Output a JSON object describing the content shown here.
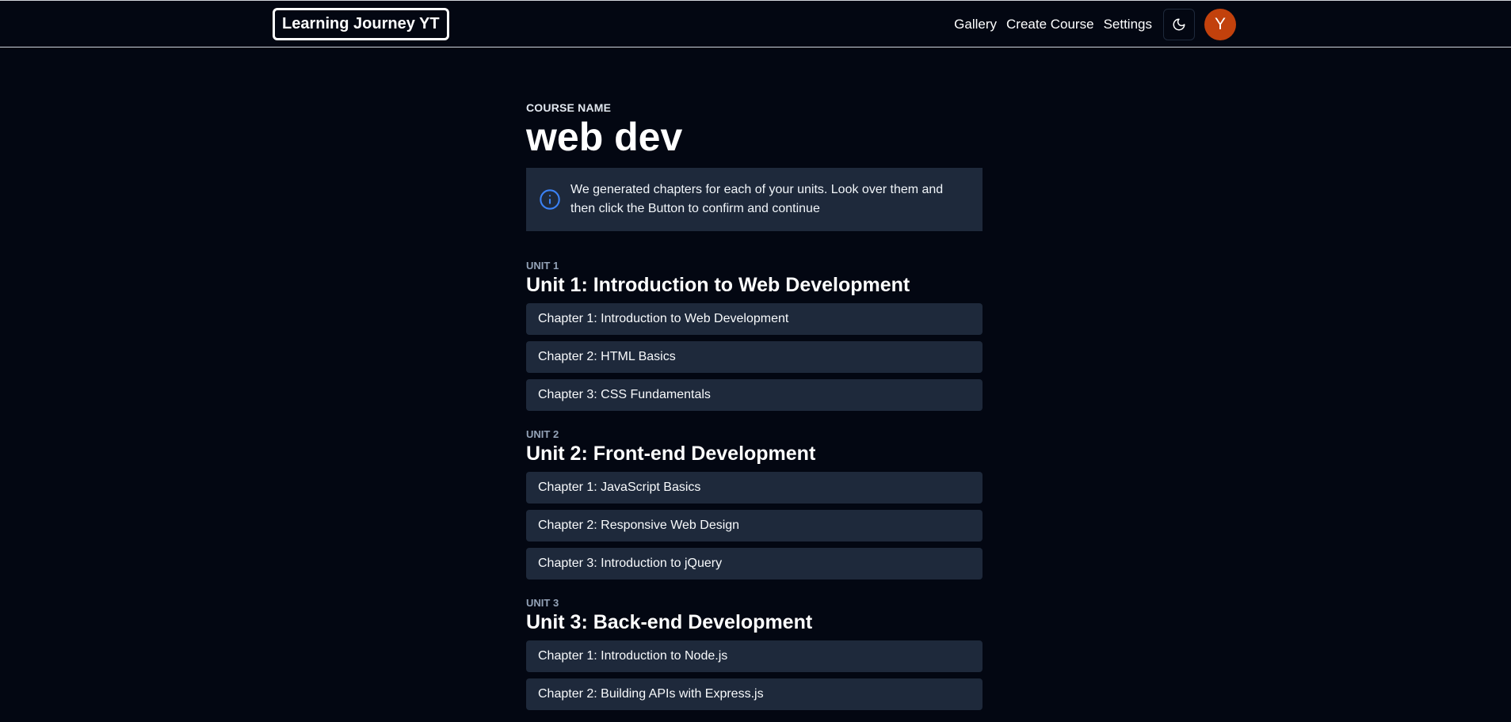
{
  "nav": {
    "logo": "Learning Journey YT",
    "links": [
      "Gallery",
      "Create Course",
      "Settings"
    ],
    "theme_icon": "moon-icon",
    "avatar_initial": "Y"
  },
  "course": {
    "label": "COURSE NAME",
    "title": "web dev"
  },
  "info": {
    "icon": "info-icon",
    "text": "We generated chapters for each of your units. Look over them and then click the Button to confirm and continue"
  },
  "units": [
    {
      "label": "UNIT 1",
      "title": "Unit 1: Introduction to Web Development",
      "chapters": [
        "Chapter 1: Introduction to Web Development",
        "Chapter 2: HTML Basics",
        "Chapter 3: CSS Fundamentals"
      ]
    },
    {
      "label": "UNIT 2",
      "title": "Unit 2: Front-end Development",
      "chapters": [
        "Chapter 1: JavaScript Basics",
        "Chapter 2: Responsive Web Design",
        "Chapter 3: Introduction to jQuery"
      ]
    },
    {
      "label": "UNIT 3",
      "title": "Unit 3: Back-end Development",
      "chapters": [
        "Chapter 1: Introduction to Node.js",
        "Chapter 2: Building APIs with Express.js"
      ]
    }
  ],
  "colors": {
    "background": "#030712",
    "card": "#1e293b",
    "avatar": "#c2410c",
    "info_icon": "#3b82f6"
  }
}
